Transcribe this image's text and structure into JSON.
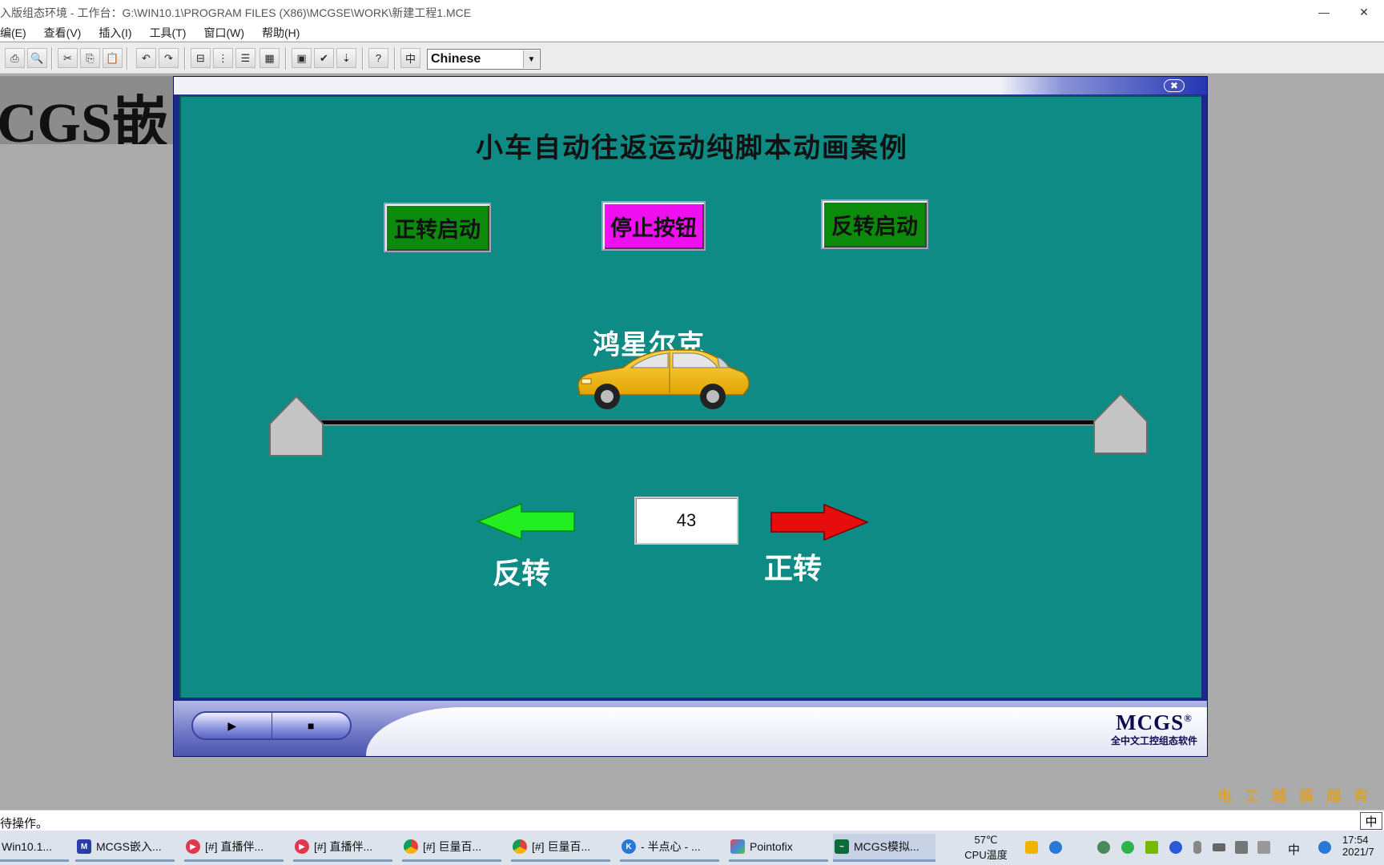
{
  "window": {
    "title": "入版组态环境 - 工作台：G:\\WIN10.1\\PROGRAM FILES (X86)\\MCGSE\\WORK\\新建工程1.MCE",
    "minimize": "—",
    "close": "✕"
  },
  "menu": [
    "编(E)",
    "查看(V)",
    "插入(I)",
    "工具(T)",
    "窗口(W)",
    "帮助(H)"
  ],
  "toolbar": {
    "language": "Chinese"
  },
  "background_brand": "CGS嵌",
  "simulator": {
    "close": "✖",
    "heading": "小车自动往返运动纯脚本动画案例",
    "forward_start": "正转启动",
    "stop_button": "停止按钮",
    "reverse_start": "反转启动",
    "car_label": "鸿星尔克",
    "position_value": "43",
    "reverse_label": "反转",
    "forward_label": "正转",
    "play": "▶",
    "stop": "■",
    "brand": "MCGS",
    "brand_mark": "®",
    "brand_sub": "全中文工控组态软件"
  },
  "watermark": "电工越搞越有",
  "status": {
    "text": "待操作。",
    "ime": "中"
  },
  "taskbar": {
    "tasks": [
      {
        "label": "Win10.1...",
        "icon": "folder-icon"
      },
      {
        "label": "MCGS嵌入...",
        "icon": "mcgs-icon"
      },
      {
        "label": "[#] 直播伴...",
        "icon": "live-icon"
      },
      {
        "label": "[#] 直播伴...",
        "icon": "live-icon"
      },
      {
        "label": "[#] 巨量百...",
        "icon": "chrome-icon"
      },
      {
        "label": "[#] 巨量百...",
        "icon": "chrome-icon"
      },
      {
        "label": "- 半点心 - ...",
        "icon": "kugou-icon"
      },
      {
        "label": "Pointofix",
        "icon": "pointofix-icon"
      },
      {
        "label": "MCGS模拟...",
        "icon": "mcgs-sim-icon"
      }
    ],
    "temp": "57℃",
    "temp_label": "CPU温度",
    "ime": "中",
    "time": "17:54",
    "date": "2021/7"
  }
}
